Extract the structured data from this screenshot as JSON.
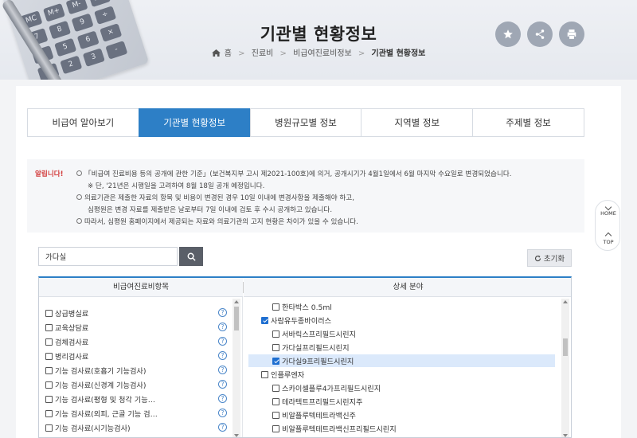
{
  "header": {
    "title": "기관별 현황정보",
    "breadcrumb": [
      "홈",
      "진료비",
      "비급여진료비정보",
      "기관별 현황정보"
    ],
    "actions": [
      {
        "name": "favorite",
        "icon": "star-icon"
      },
      {
        "name": "share",
        "icon": "share-icon"
      },
      {
        "name": "print",
        "icon": "print-icon"
      }
    ],
    "calculator_keys": [
      "MC",
      "M+",
      "M-",
      "MR",
      "7",
      "8",
      "9",
      "÷",
      "4",
      "5",
      "6",
      "×",
      "1",
      "2",
      "3",
      "-"
    ]
  },
  "tabs": [
    {
      "label": "비급여 알아보기",
      "active": false
    },
    {
      "label": "기관별 현황정보",
      "active": true
    },
    {
      "label": "병원규모별 정보",
      "active": false
    },
    {
      "label": "지역별 정보",
      "active": false
    },
    {
      "label": "주제별 정보",
      "active": false
    }
  ],
  "notice": {
    "label": "알립니다!",
    "lines": [
      "「비급여 진료비용 등의 공개에 관한 기준」(보건복지부 고시 제2021-100호)에 의거, 공개시기가 4월1일에서 6월 마지막 수요일로 변경되었습니다.",
      "※ 단, '21년은 시행일을 고려하여 8월 18일 공개 예정입니다.",
      "의료기관은 제출한 자료의 항목 및 비용이 변경된 경우 10일 이내에 변경사항을 제출해야 하고,",
      "심평원은 변경 자료를 제출받은 날로부터 7일 이내에 검토 후 수시 공개하고 있습니다.",
      "따라서, 심평원 홈페이지에서 제공되는 자료와 의료기관의 고지 현황은 차이가 있을 수 있습니다."
    ]
  },
  "search": {
    "value": "가다실",
    "reset_label": "초기화"
  },
  "panels": {
    "left_header": "비급여진료비항목",
    "right_header": "상세 분야",
    "left_items": [
      "상급병실료",
      "교육상담료",
      "검체검사료",
      "병리검사료",
      "기능 검사료(호흡기 기능검사)",
      "기능 검사료(신경계 기능검사)",
      "기능 검사료(평형 및 청각 기능…",
      "기능 검사료(외피, 근골 기능 검…",
      "기능 검사료(시기능검사)"
    ],
    "right_items": [
      {
        "label": "한타박스 0.5ml",
        "level": 1,
        "checked": false,
        "selected": false
      },
      {
        "label": "사람유두종바이러스",
        "level": 0,
        "checked": true,
        "selected": false
      },
      {
        "label": "서바릭스프리필드시린지",
        "level": 1,
        "checked": false,
        "selected": false
      },
      {
        "label": "가다실프리필드시린지",
        "level": 1,
        "checked": false,
        "selected": false
      },
      {
        "label": "가다실9프리필드시린지",
        "level": 1,
        "checked": true,
        "selected": true
      },
      {
        "label": "인플루엔자",
        "level": 0,
        "checked": false,
        "selected": false
      },
      {
        "label": "스카이셀플루4가프리필드시린지",
        "level": 1,
        "checked": false,
        "selected": false
      },
      {
        "label": "테라텍트프리필드시린지주",
        "level": 1,
        "checked": false,
        "selected": false
      },
      {
        "label": "비알플루텍테트라백신주",
        "level": 1,
        "checked": false,
        "selected": false
      },
      {
        "label": "비알플루텍테트라백신프리필드시린지",
        "level": 1,
        "checked": false,
        "selected": false
      }
    ]
  },
  "side": {
    "home_label": "HOME",
    "top_label": "TOP"
  },
  "colors": {
    "accent": "#2d7fc6",
    "notice_label": "#d23b3b",
    "selected_row": "#dbe9fb"
  }
}
